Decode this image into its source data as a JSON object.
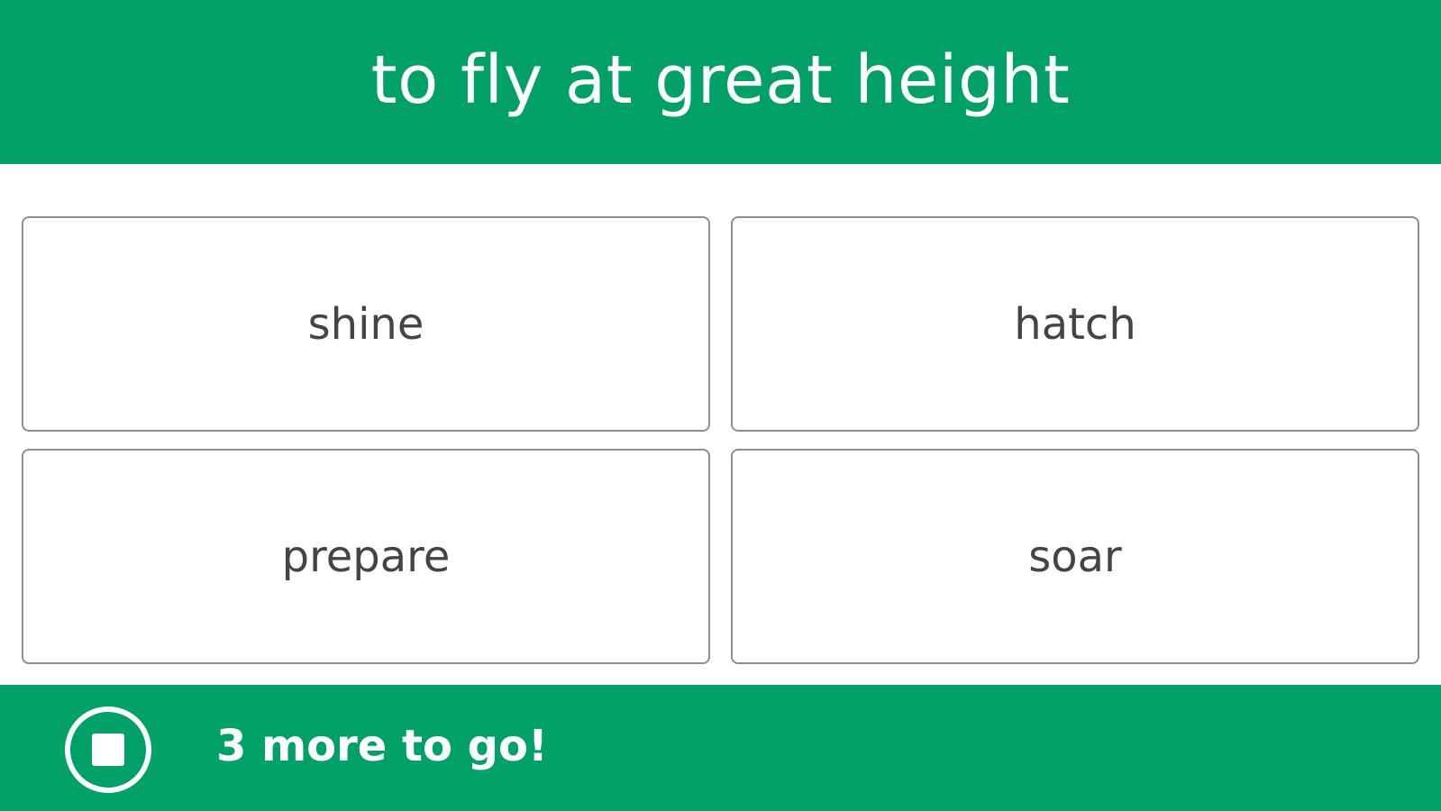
{
  "question": {
    "prompt": "to fly at great height"
  },
  "choices": [
    {
      "label": "shine"
    },
    {
      "label": "hatch"
    },
    {
      "label": "prepare"
    },
    {
      "label": "soar"
    }
  ],
  "footer": {
    "stop_icon": "stop-icon",
    "progress_text": "3 more to go!"
  },
  "colors": {
    "brand_green": "#00a066",
    "choice_border": "#8e8e8e",
    "choice_text": "#444444"
  }
}
